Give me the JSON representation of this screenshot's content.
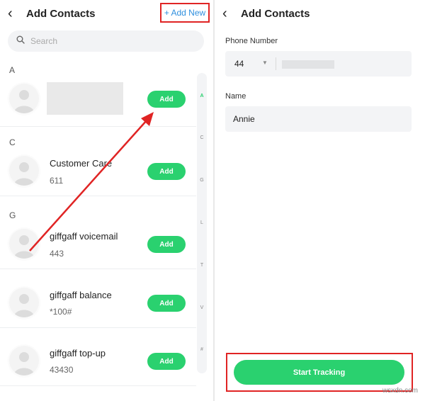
{
  "left_panel": {
    "title": "Add Contacts",
    "add_new_label": "+ Add New",
    "search_placeholder": "Search",
    "sections": [
      {
        "letter": "A",
        "contacts": [
          {
            "name": "",
            "number": "",
            "redacted": true,
            "add_label": "Add"
          }
        ]
      },
      {
        "letter": "C",
        "contacts": [
          {
            "name": "Customer Care",
            "number": "611",
            "add_label": "Add"
          }
        ]
      },
      {
        "letter": "G",
        "contacts": [
          {
            "name": "giffgaff voicemail",
            "number": "443",
            "add_label": "Add"
          },
          {
            "name": "giffgaff balance",
            "number": "*100#",
            "add_label": "Add"
          },
          {
            "name": "giffgaff top-up",
            "number": "43430",
            "add_label": "Add"
          }
        ]
      }
    ],
    "index_letters": [
      "A",
      "C",
      "G",
      "L",
      "T",
      "V",
      "#"
    ],
    "active_index": "A"
  },
  "right_panel": {
    "title": "Add Contacts",
    "phone_label": "Phone Number",
    "country_code": "44",
    "phone_value": "",
    "name_label": "Name",
    "name_value": "Annie",
    "start_button": "Start Tracking"
  },
  "watermark": "wsxdn.com",
  "colors": {
    "accent_green": "#2ad16f",
    "link_blue": "#2f8fde",
    "annotation_red": "#e02424"
  },
  "icons": {
    "back": "chevron-left-icon",
    "search": "search-icon",
    "avatar": "person-avatar-icon",
    "dropdown": "caret-down-icon"
  }
}
